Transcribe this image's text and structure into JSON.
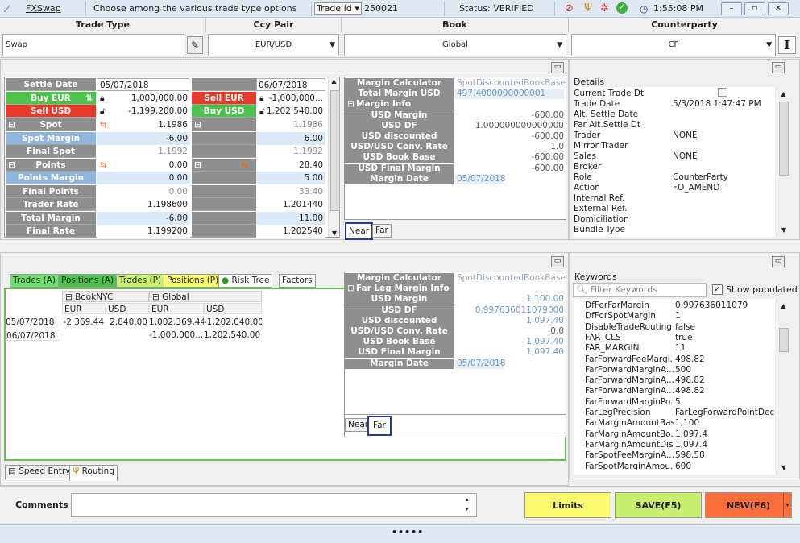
{
  "titlebar": {
    "app": "FXSwap",
    "message": "Choose among the various trade type options",
    "trade_id_label": "Trade Id",
    "trade_id": "250021",
    "status": "Status: VERIFIED",
    "time": "1:55:08 PM"
  },
  "headers": {
    "trade_type": "Trade Type",
    "ccy_pair": "Ccy Pair",
    "book": "Book",
    "counterparty": "Counterparty"
  },
  "combos": {
    "trade_type": "Swap",
    "ccy_pair": "EUR/USD",
    "book": "Global",
    "counterparty": "CP"
  },
  "near": {
    "settle_label": "Settle Date",
    "settle": "05/07/2018",
    "buy_label": "Buy EUR",
    "buy": "1,000,000.00",
    "sell_label": "Sell USD",
    "sell": "-1,199,200.00",
    "spot_label": "Spot",
    "spot": "1.1986",
    "spot_margin_label": "Spot Margin",
    "spot_margin": "-6.00",
    "final_spot_label": "Final Spot",
    "final_spot": "1.1992",
    "points_label": "Points",
    "points": "0.00",
    "points_margin_label": "Points Margin",
    "points_margin": "0.00",
    "final_points_label": "Final Points",
    "final_points": "0.00",
    "trader_rate_label": "Trader Rate",
    "trader_rate": "1.198600",
    "total_margin_label": "Total Margin",
    "total_margin": "-6.00",
    "final_rate_label": "Final Rate",
    "final_rate": "1.199200"
  },
  "far": {
    "settle": "06/07/2018",
    "tenor": "1M",
    "sell_label": "Sell EUR",
    "sell": "-1,000,000...",
    "buy_label": "Buy USD",
    "buy": "1,202,540.00",
    "spot": "1.1986",
    "spot_margin": "6.00",
    "final_spot": "1.1992",
    "points": "28.40",
    "points_margin": "5.00",
    "final_points": "33.40",
    "trader_rate": "1.201440",
    "total_margin": "11.00",
    "final_rate": "1.202540"
  },
  "margin_near": [
    {
      "l": "Margin Calculator",
      "v": "SpotDiscountedBookBase"
    },
    {
      "l": "Total Margin USD",
      "v": "497.4000000000001"
    },
    {
      "l": "Margin Info",
      "v": ""
    },
    {
      "l": "USD Margin",
      "v": "-600.00"
    },
    {
      "l": "USD DF",
      "v": "1.000000000000000"
    },
    {
      "l": "USD discounted",
      "v": "-600.00"
    },
    {
      "l": "USD/USD Conv. Rate",
      "v": "1.0"
    },
    {
      "l": "USD Book Base",
      "v": "-600.00"
    },
    {
      "l": "USD Final Margin",
      "v": "-600.00"
    },
    {
      "l": "Margin Date",
      "v": "05/07/2018"
    }
  ],
  "margin_far": [
    {
      "l": "Margin Calculator",
      "v": "SpotDiscountedBookBase"
    },
    {
      "l": "Far Leg Margin Info",
      "v": ""
    },
    {
      "l": "USD Margin",
      "v": "1,100.00"
    },
    {
      "l": "USD DF",
      "v": "0.997636011079000"
    },
    {
      "l": "USD discounted",
      "v": "1,097.40"
    },
    {
      "l": "USD/USD Conv. Rate",
      "v": "0.0"
    },
    {
      "l": "USD Book Base",
      "v": "1,097.40"
    },
    {
      "l": "USD Final Margin",
      "v": "1,097.40"
    },
    {
      "l": "Margin Date",
      "v": "05/07/2018"
    }
  ],
  "leg_tabs": {
    "near": "Near",
    "far": "Far"
  },
  "details": {
    "title": "Details",
    "rows": [
      {
        "k": "Current Trade Dt",
        "v": ""
      },
      {
        "k": "Trade Date",
        "v": "5/3/2018 1:47:47 PM"
      },
      {
        "k": "Alt. Settle Date",
        "v": ""
      },
      {
        "k": "Far Alt.Settle Dt",
        "v": ""
      },
      {
        "k": "Trader",
        "v": "NONE"
      },
      {
        "k": "Mirror Trader",
        "v": ""
      },
      {
        "k": "Sales",
        "v": "NONE"
      },
      {
        "k": "Broker",
        "v": ""
      },
      {
        "k": "Role",
        "v": "CounterParty"
      },
      {
        "k": "Action",
        "v": "FO_AMEND"
      },
      {
        "k": "Internal Ref.",
        "v": ""
      },
      {
        "k": "External Ref.",
        "v": ""
      },
      {
        "k": "Domiciliation",
        "v": ""
      },
      {
        "k": "Bundle Type",
        "v": ""
      }
    ]
  },
  "lower_tabs": [
    "Trades (A)",
    "Positions (A)",
    "Trades (P)",
    "Positions (P)",
    "Risk Tree",
    "Factors"
  ],
  "trades": {
    "book1": "BookNYC",
    "book2": "Global",
    "cols": [
      "EUR",
      "USD",
      "EUR",
      "USD"
    ],
    "rows": [
      {
        "date": "05/07/2018",
        "c1": "-2,369.44",
        "c2": "2,840.00",
        "c3": "1,002,369.44",
        "c4": "-1,202,040.00"
      },
      {
        "date": "06/07/2018",
        "c1": "",
        "c2": "",
        "c3": "-1,000,000....",
        "c4": "1,202,540.00"
      }
    ]
  },
  "bottom_tabs": {
    "speed": "Speed Entry",
    "routing": "Routing"
  },
  "keywords": {
    "title": "Keywords",
    "filter_placeholder": "Filter Keywords",
    "show_populated": "Show populated",
    "rows": [
      {
        "k": "DfForFarMargin",
        "v": "0.997636011079"
      },
      {
        "k": "DfForSpotMargin",
        "v": "1"
      },
      {
        "k": "DisableTradeRouting",
        "v": "false"
      },
      {
        "k": "FAR_CLS",
        "v": "true"
      },
      {
        "k": "FAR_MARGIN",
        "v": "11"
      },
      {
        "k": "FarForwardFeeMargi...",
        "v": "498.82"
      },
      {
        "k": "FarForwardMarginA...",
        "v": "500"
      },
      {
        "k": "FarForwardMarginA...",
        "v": "498.82"
      },
      {
        "k": "FarForwardMarginA...",
        "v": "498.82"
      },
      {
        "k": "FarForwardMarginPo...",
        "v": "5"
      },
      {
        "k": "FarLegPrecision",
        "v": "FarLegForwardPointDec..."
      },
      {
        "k": "FarMarginAmountBasis",
        "v": "1,100"
      },
      {
        "k": "FarMarginAmountBo...",
        "v": "1,097.4"
      },
      {
        "k": "FarMarginAmountDis...",
        "v": "1,097.4"
      },
      {
        "k": "FarSpotFeeMarginA...",
        "v": "598.58"
      },
      {
        "k": "FarSpotMarginAmou...",
        "v": "600"
      }
    ]
  },
  "comments_label": "Comments",
  "buttons": {
    "limits": "Limits",
    "save": "SAVE(F5)",
    "new": "NEW(F6)"
  },
  "colors": {
    "buy": "#4dc24d",
    "sell": "#ea3b2a",
    "limits": "#fafa6e",
    "save": "#c8f06e",
    "new": "#fa6e3c"
  }
}
